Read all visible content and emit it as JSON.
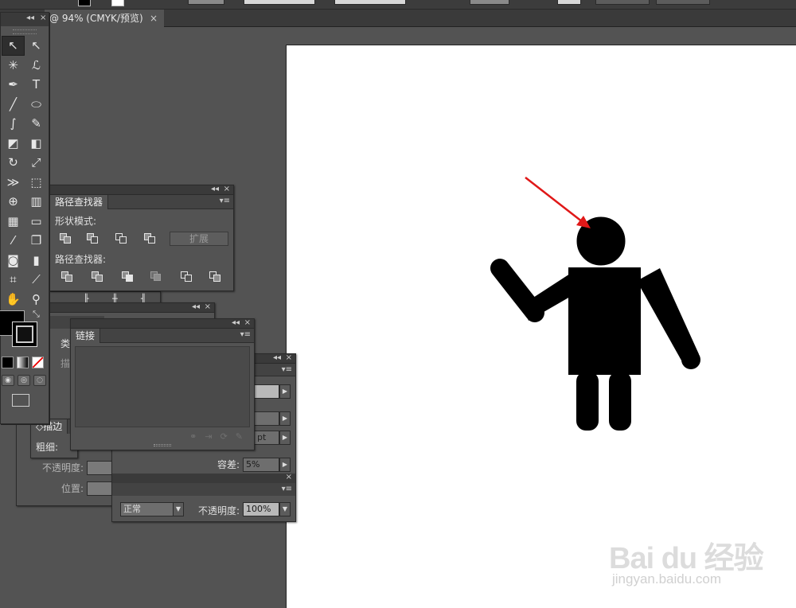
{
  "document_tab": {
    "title": "@ 94% (CMYK/预览)",
    "close": "×"
  },
  "tools_panel": {
    "collapse": "◂◂",
    "close": "×",
    "tools": [
      {
        "name": "selection-tool",
        "glyph": "↖"
      },
      {
        "name": "direct-selection-tool",
        "glyph": "↖"
      },
      {
        "name": "magic-wand-tool",
        "glyph": "✳"
      },
      {
        "name": "lasso-tool",
        "glyph": "ℒ"
      },
      {
        "name": "pen-tool",
        "glyph": "✒"
      },
      {
        "name": "type-tool",
        "glyph": "T"
      },
      {
        "name": "line-tool",
        "glyph": "╱"
      },
      {
        "name": "ellipse-tool",
        "glyph": "⬭"
      },
      {
        "name": "paintbrush-tool",
        "glyph": "∫"
      },
      {
        "name": "pencil-tool",
        "glyph": "✎"
      },
      {
        "name": "blob-brush-tool",
        "glyph": "◩"
      },
      {
        "name": "eraser-tool",
        "glyph": "◧"
      },
      {
        "name": "rotate-tool",
        "glyph": "↻"
      },
      {
        "name": "scale-tool",
        "glyph": "⤢"
      },
      {
        "name": "width-tool",
        "glyph": "≫"
      },
      {
        "name": "free-transform-tool",
        "glyph": "⬚"
      },
      {
        "name": "shape-builder-tool",
        "glyph": "⊕"
      },
      {
        "name": "graph-tool",
        "glyph": "▥"
      },
      {
        "name": "mesh-tool",
        "glyph": "▦"
      },
      {
        "name": "gradient-tool",
        "glyph": "▭"
      },
      {
        "name": "eyedropper-tool",
        "glyph": "⁄"
      },
      {
        "name": "blend-tool",
        "glyph": "❐"
      },
      {
        "name": "symbol-sprayer-tool",
        "glyph": "◙"
      },
      {
        "name": "column-graph-tool",
        "glyph": "▮"
      },
      {
        "name": "artboard-tool",
        "glyph": "⌗"
      },
      {
        "name": "slice-tool",
        "glyph": "⟋"
      },
      {
        "name": "hand-tool",
        "glyph": "✋"
      },
      {
        "name": "zoom-tool",
        "glyph": "⚲"
      }
    ],
    "swap": "⤡"
  },
  "pathfinder_panel": {
    "tab_label": "路径查找器",
    "collapse": "◂◂",
    "close": "×",
    "menu": "▾≡",
    "shape_modes_label": "形状模式:",
    "expand_label": "扩展",
    "pathfinders_label": "路径查找器:"
  },
  "links_panel": {
    "tab_label": "链接",
    "collapse": "◂◂",
    "close": "×",
    "menu": "▾≡",
    "footer_icons": [
      "⚭",
      "⇥",
      "⟳",
      "✎"
    ]
  },
  "stroke_panel": {
    "tab_label": "◇描边",
    "weight_label": "粗细:",
    "partial_label": "类",
    "partial_label2": "描"
  },
  "mid_panel": {
    "collapse": "◂◂",
    "close": "×",
    "opacity_label": "不透明度:",
    "position_label": "位置:"
  },
  "right_panel": {
    "collapse": "◂◂",
    "close": "×",
    "menu": "▾≡",
    "unit_value": "pt",
    "tolerance_label": "容差:",
    "tolerance_value": "5%",
    "menu2": "▾≡",
    "blend_mode": "正常",
    "opacity_label": "不透明度:",
    "opacity_value": "100%",
    "close2": "×"
  },
  "behind_strip": {
    "collapse": "◂◂",
    "close": "×",
    "icons": [
      "╟",
      "╫",
      "╢"
    ]
  },
  "watermark": {
    "brand": "Bai du 经验",
    "url": "jingyan.baidu.com"
  }
}
